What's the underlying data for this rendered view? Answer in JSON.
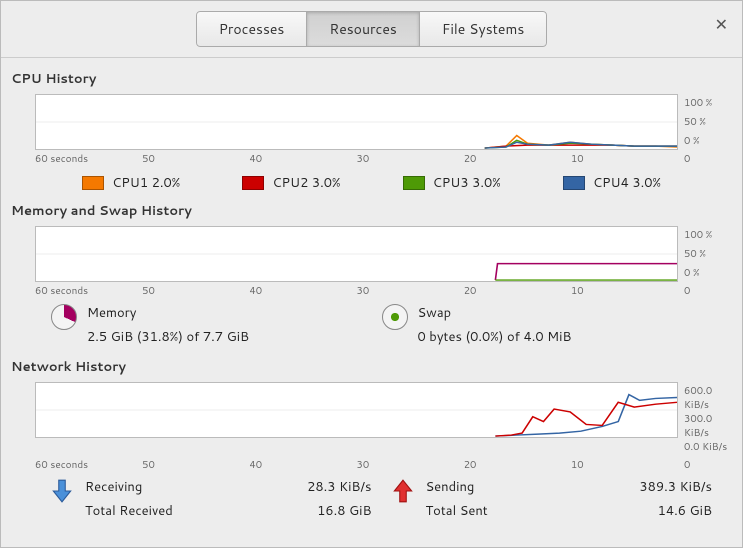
{
  "window": {
    "close_glyph": "✕"
  },
  "tabs": {
    "processes": "Processes",
    "resources": "Resources",
    "filesystems": "File Systems"
  },
  "xaxis": {
    "t60": "60 seconds",
    "t50": "50",
    "t40": "40",
    "t30": "30",
    "t20": "20",
    "t10": "10",
    "t0": "0"
  },
  "cpu": {
    "title": "CPU History",
    "y_top": "100 %",
    "y_mid": "50 %",
    "y_bot": "0 %",
    "legend": {
      "cpu1": {
        "label": "CPU1  2.0%",
        "color": "#f57900"
      },
      "cpu2": {
        "label": "CPU2  3.0%",
        "color": "#cc0000"
      },
      "cpu3": {
        "label": "CPU3  3.0%",
        "color": "#4e9a06"
      },
      "cpu4": {
        "label": "CPU4  3.0%",
        "color": "#3465a4"
      }
    }
  },
  "mem": {
    "title": "Memory and Swap History",
    "y_top": "100 %",
    "y_mid": "50 %",
    "y_bot": "0 %",
    "memory_label": "Memory",
    "memory_value": "2.5 GiB (31.8%) of 7.7 GiB",
    "swap_label": "Swap",
    "swap_value": "0 bytes (0.0%) of 4.0 MiB",
    "colors": {
      "memory": "#a40060",
      "swap": "#4e9a06"
    }
  },
  "net": {
    "title": "Network History",
    "y_top": "600.0 KiB/s",
    "y_mid": "300.0 KiB/s",
    "y_bot": "0.0 KiB/s",
    "receiving_label": "Receiving",
    "receiving_rate": "28.3 KiB/s",
    "total_received_label": "Total Received",
    "total_received_value": "16.8 GiB",
    "sending_label": "Sending",
    "sending_rate": "389.3 KiB/s",
    "total_sent_label": "Total Sent",
    "total_sent_value": "14.6 GiB",
    "colors": {
      "receiving": "#3465a4",
      "sending": "#cc0000"
    }
  },
  "chart_data": [
    {
      "type": "line",
      "title": "CPU History",
      "xlabel": "seconds",
      "ylabel": "%",
      "xlim": [
        0,
        60
      ],
      "ylim": [
        0,
        100
      ],
      "x": [
        60,
        50,
        40,
        30,
        20,
        18,
        16,
        14,
        12,
        10,
        8,
        6,
        4,
        2,
        0
      ],
      "series": [
        {
          "name": "CPU1",
          "color": "#f57900",
          "values": [
            0,
            0,
            0,
            0,
            0,
            2,
            22,
            8,
            4,
            10,
            6,
            5,
            4,
            3,
            2
          ]
        },
        {
          "name": "CPU2",
          "color": "#cc0000",
          "values": [
            0,
            0,
            0,
            0,
            0,
            2,
            6,
            4,
            3,
            5,
            4,
            4,
            3,
            3,
            3
          ]
        },
        {
          "name": "CPU3",
          "color": "#4e9a06",
          "values": [
            0,
            0,
            0,
            0,
            0,
            1,
            12,
            5,
            3,
            6,
            5,
            4,
            3,
            3,
            3
          ]
        },
        {
          "name": "CPU4",
          "color": "#3465a4",
          "values": [
            0,
            0,
            0,
            0,
            0,
            1,
            8,
            4,
            3,
            9,
            6,
            5,
            3,
            3,
            3
          ]
        }
      ]
    },
    {
      "type": "line",
      "title": "Memory and Swap History",
      "xlabel": "seconds",
      "ylabel": "%",
      "xlim": [
        0,
        60
      ],
      "ylim": [
        0,
        100
      ],
      "x": [
        60,
        50,
        40,
        30,
        20,
        18,
        16,
        14,
        12,
        10,
        8,
        6,
        4,
        2,
        0
      ],
      "series": [
        {
          "name": "Memory",
          "color": "#a40060",
          "values": [
            0,
            0,
            0,
            0,
            0,
            32,
            32,
            32,
            32,
            32,
            32,
            32,
            32,
            32,
            32
          ]
        },
        {
          "name": "Swap",
          "color": "#4e9a06",
          "values": [
            0,
            0,
            0,
            0,
            0,
            0,
            0,
            0,
            0,
            0,
            0,
            0,
            0,
            0,
            0
          ]
        }
      ]
    },
    {
      "type": "line",
      "title": "Network History",
      "xlabel": "seconds",
      "ylabel": "KiB/s",
      "xlim": [
        0,
        60
      ],
      "ylim": [
        0,
        600
      ],
      "x": [
        60,
        50,
        40,
        30,
        20,
        18,
        16,
        14,
        12,
        10,
        8,
        6,
        4,
        2,
        0
      ],
      "series": [
        {
          "name": "Receiving",
          "color": "#3465a4",
          "values": [
            0,
            0,
            0,
            0,
            0,
            5,
            10,
            15,
            20,
            30,
            60,
            150,
            480,
            410,
            430
          ]
        },
        {
          "name": "Sending",
          "color": "#cc0000",
          "values": [
            0,
            0,
            0,
            0,
            0,
            10,
            20,
            200,
            160,
            290,
            260,
            130,
            400,
            350,
            389
          ]
        }
      ]
    }
  ]
}
